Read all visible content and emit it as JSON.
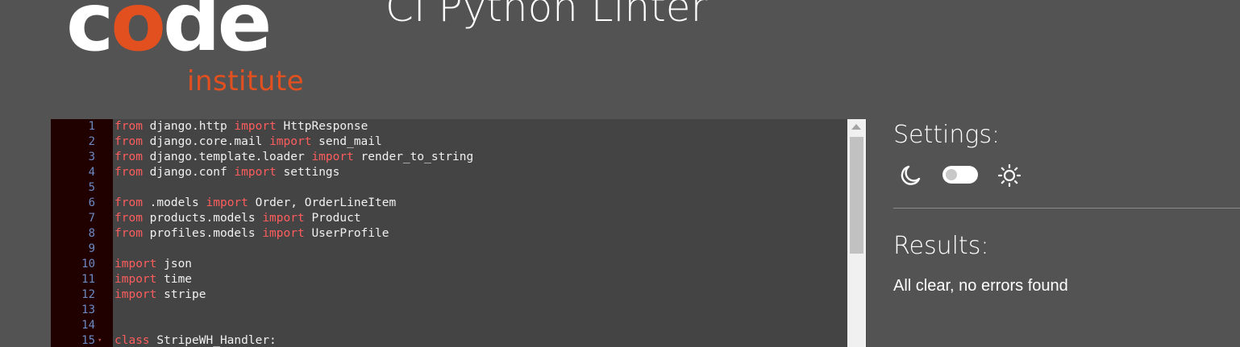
{
  "header": {
    "logo_word_start": "c",
    "logo_word_accent": "o",
    "logo_word_end": "de",
    "logo_subtitle": "institute",
    "title": "CI Python Linter"
  },
  "colors": {
    "background": "#535353",
    "brand_orange": "#e2501f",
    "keyword": "#ff5d5d",
    "line_number": "#6d8ac2",
    "gutter": "#210000",
    "editor": "#444444"
  },
  "editor": {
    "lines": [
      {
        "n": "1",
        "fold": "",
        "parts": [
          {
            "t": "from",
            "k": true
          },
          {
            "t": " django.http ",
            "k": false
          },
          {
            "t": "import",
            "k": true
          },
          {
            "t": " HttpResponse",
            "k": false
          }
        ]
      },
      {
        "n": "2",
        "fold": "",
        "parts": [
          {
            "t": "from",
            "k": true
          },
          {
            "t": " django.core.mail ",
            "k": false
          },
          {
            "t": "import",
            "k": true
          },
          {
            "t": " send_mail",
            "k": false
          }
        ]
      },
      {
        "n": "3",
        "fold": "",
        "parts": [
          {
            "t": "from",
            "k": true
          },
          {
            "t": " django.template.loader ",
            "k": false
          },
          {
            "t": "import",
            "k": true
          },
          {
            "t": " render_to_string",
            "k": false
          }
        ]
      },
      {
        "n": "4",
        "fold": "",
        "parts": [
          {
            "t": "from",
            "k": true
          },
          {
            "t": " django.conf ",
            "k": false
          },
          {
            "t": "import",
            "k": true
          },
          {
            "t": " settings",
            "k": false
          }
        ]
      },
      {
        "n": "5",
        "fold": "",
        "parts": []
      },
      {
        "n": "6",
        "fold": "",
        "parts": [
          {
            "t": "from",
            "k": true
          },
          {
            "t": " .models ",
            "k": false
          },
          {
            "t": "import",
            "k": true
          },
          {
            "t": " Order, OrderLineItem",
            "k": false
          }
        ]
      },
      {
        "n": "7",
        "fold": "",
        "parts": [
          {
            "t": "from",
            "k": true
          },
          {
            "t": " products.models ",
            "k": false
          },
          {
            "t": "import",
            "k": true
          },
          {
            "t": " Product",
            "k": false
          }
        ]
      },
      {
        "n": "8",
        "fold": "",
        "parts": [
          {
            "t": "from",
            "k": true
          },
          {
            "t": " profiles.models ",
            "k": false
          },
          {
            "t": "import",
            "k": true
          },
          {
            "t": " UserProfile",
            "k": false
          }
        ]
      },
      {
        "n": "9",
        "fold": "",
        "parts": []
      },
      {
        "n": "10",
        "fold": "",
        "parts": [
          {
            "t": "import",
            "k": true
          },
          {
            "t": " json",
            "k": false
          }
        ]
      },
      {
        "n": "11",
        "fold": "",
        "parts": [
          {
            "t": "import",
            "k": true
          },
          {
            "t": " time",
            "k": false
          }
        ]
      },
      {
        "n": "12",
        "fold": "",
        "parts": [
          {
            "t": "import",
            "k": true
          },
          {
            "t": " stripe",
            "k": false
          }
        ]
      },
      {
        "n": "13",
        "fold": "",
        "parts": []
      },
      {
        "n": "14",
        "fold": "",
        "parts": []
      },
      {
        "n": "15",
        "fold": "▾",
        "parts": [
          {
            "t": "class",
            "k": true
          },
          {
            "t": " StripeWH_Handler:",
            "k": false
          }
        ]
      }
    ]
  },
  "settings": {
    "title": "Settings:",
    "dark_icon": "moon-icon",
    "light_icon": "sun-icon",
    "theme_toggle_on": false
  },
  "results": {
    "title": "Results:",
    "message": "All clear, no errors found"
  }
}
